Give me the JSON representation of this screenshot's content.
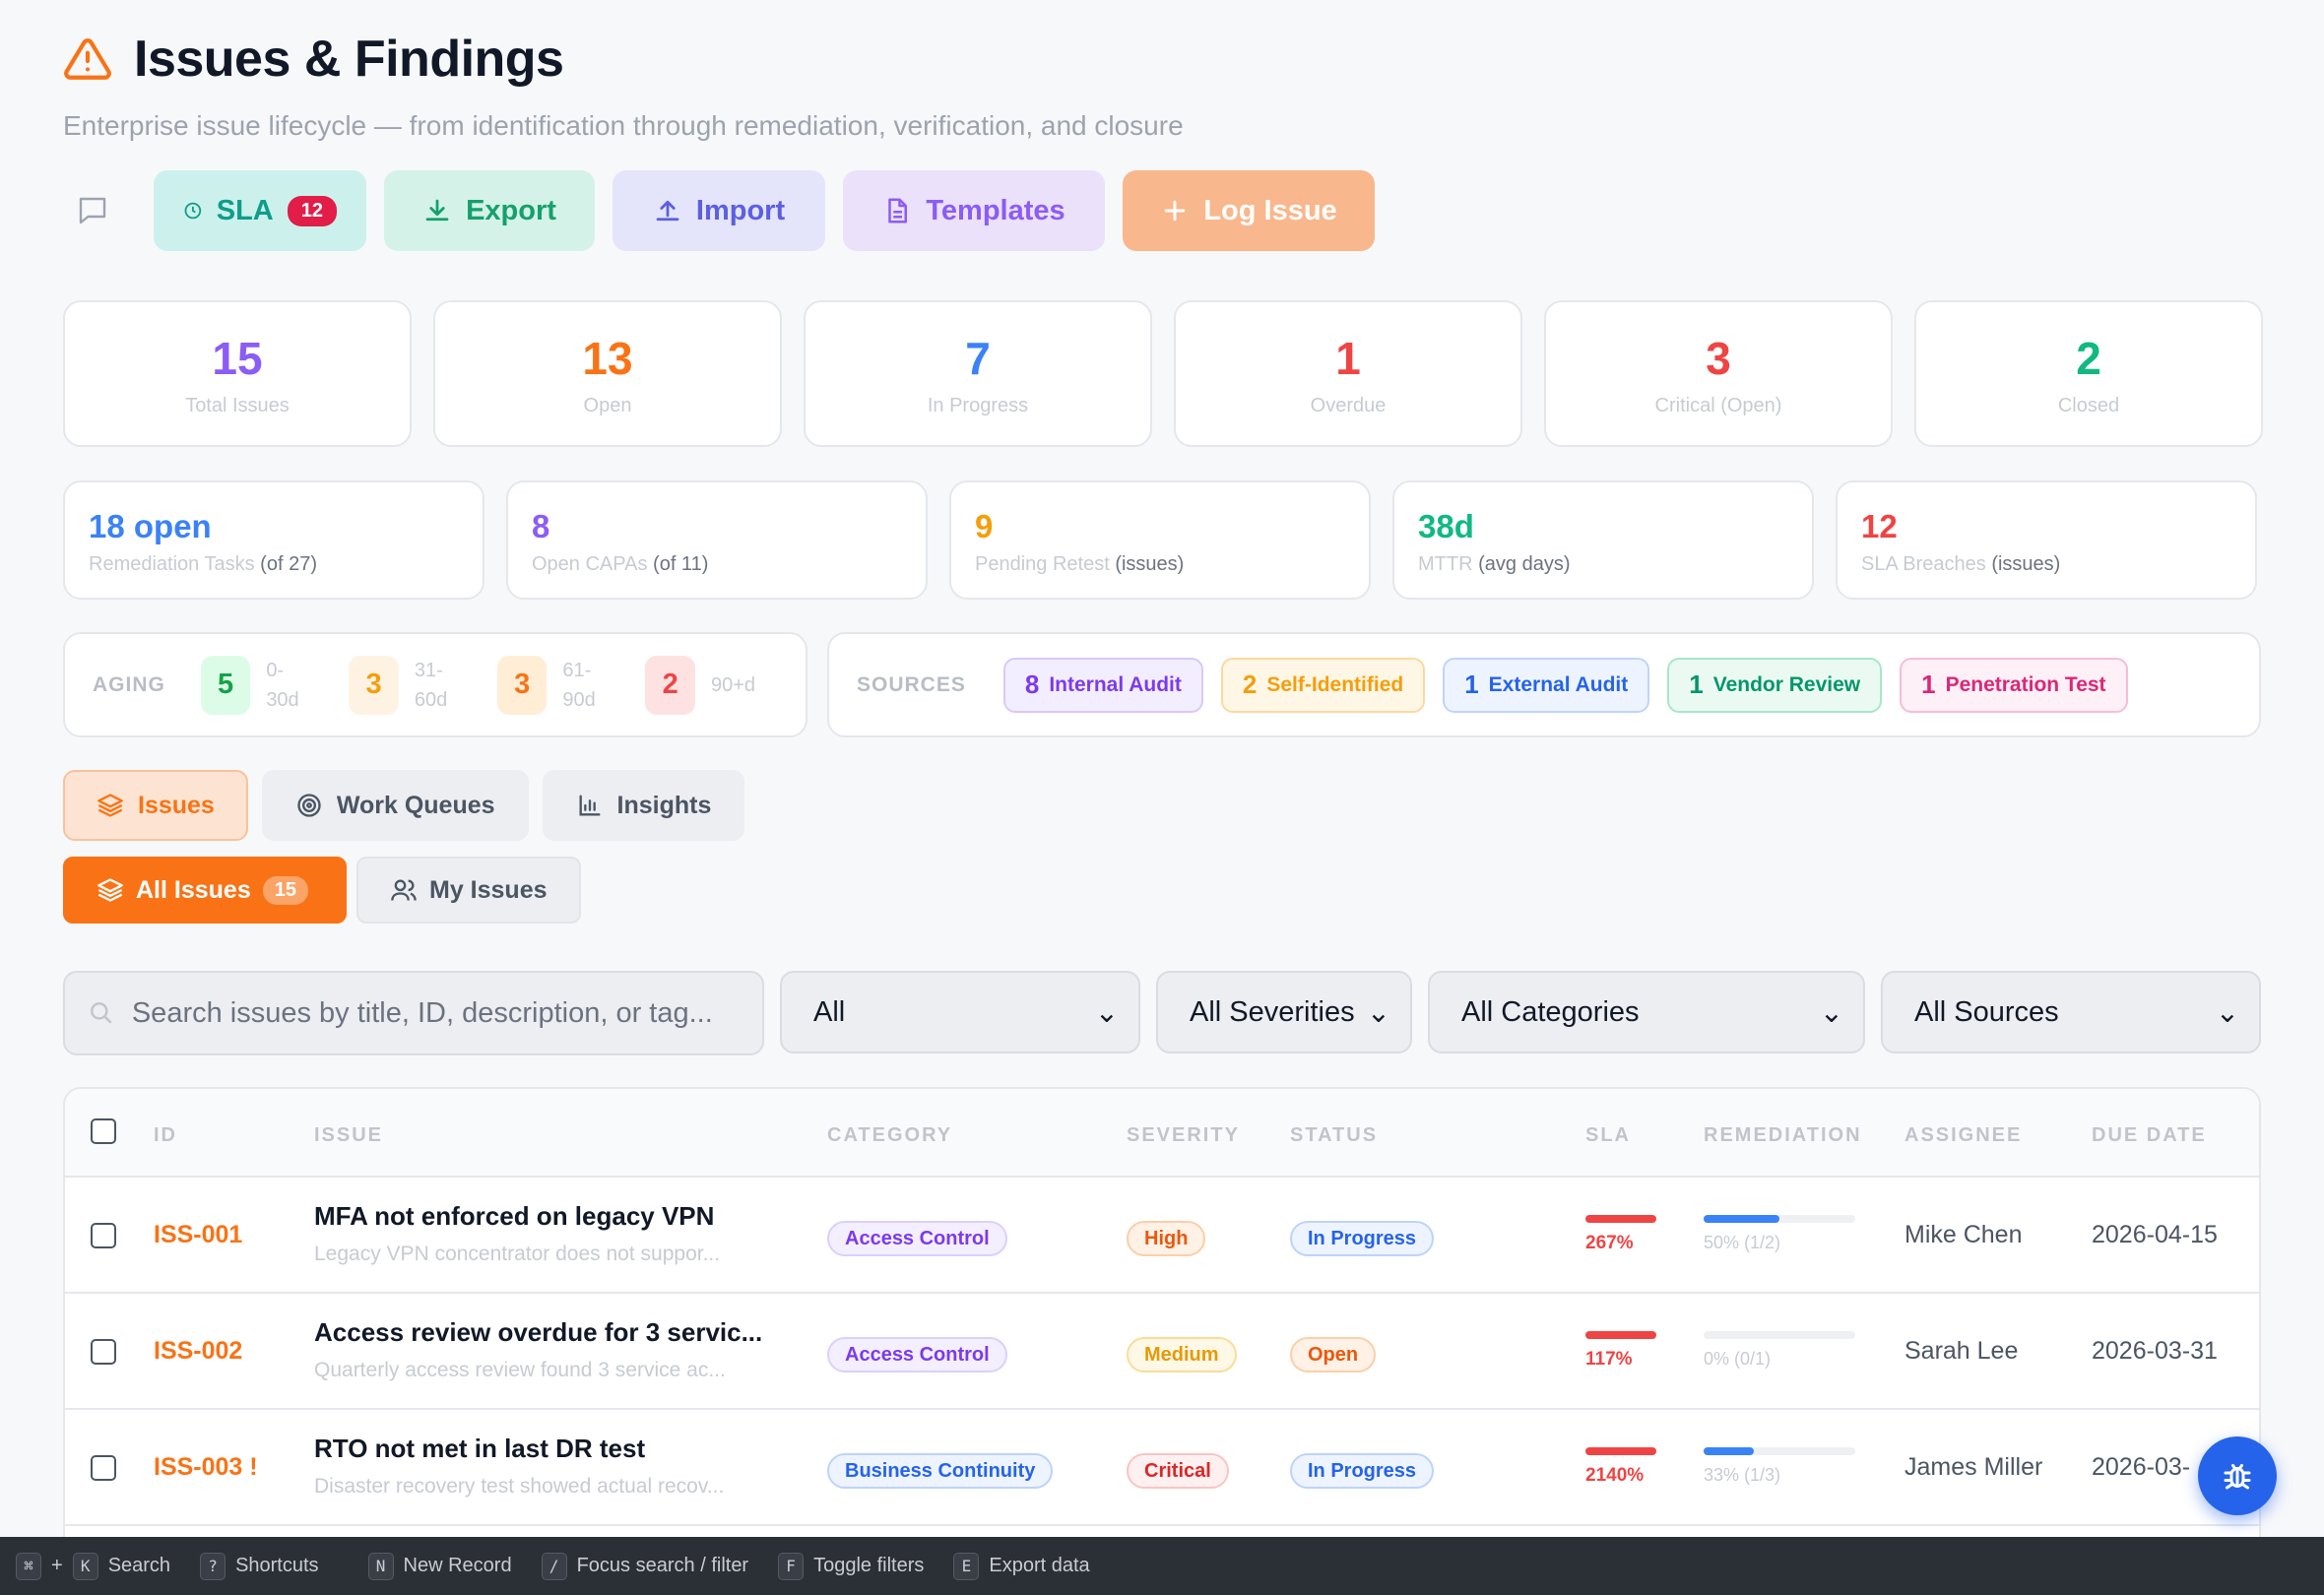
{
  "header": {
    "title": "Issues & Findings",
    "subtitle": "Enterprise issue lifecycle — from identification through remediation, verification, and closure"
  },
  "toolbar": {
    "sla_label": "SLA",
    "sla_count": "12",
    "export_label": "Export",
    "import_label": "Import",
    "templates_label": "Templates",
    "log_label": "Log Issue"
  },
  "stats": [
    {
      "value": "15",
      "label": "Total Issues",
      "color": "#8b5cf6"
    },
    {
      "value": "13",
      "label": "Open",
      "color": "#f97316"
    },
    {
      "value": "7",
      "label": "In Progress",
      "color": "#3b82f6"
    },
    {
      "value": "1",
      "label": "Overdue",
      "color": "#ef4444"
    },
    {
      "value": "3",
      "label": "Critical (Open)",
      "color": "#ef4444"
    },
    {
      "value": "2",
      "label": "Closed",
      "color": "#10b981"
    }
  ],
  "metrics": [
    {
      "value": "18 open",
      "label": "Remediation Tasks",
      "extra": "(of 27)",
      "color": "#3b82f6"
    },
    {
      "value": "8",
      "label": "Open CAPAs",
      "extra": "(of 11)",
      "color": "#8b5cf6"
    },
    {
      "value": "9",
      "label": "Pending Retest",
      "extra": "(issues)",
      "color": "#f59e0b"
    },
    {
      "value": "38d",
      "label": "MTTR",
      "extra": "(avg days)",
      "color": "#10b981"
    },
    {
      "value": "12",
      "label": "SLA Breaches",
      "extra": "(issues)",
      "color": "#ef4444"
    }
  ],
  "aging": {
    "header": "AGING",
    "buckets": [
      {
        "count": "5",
        "l1": "0-",
        "l2": "30d"
      },
      {
        "count": "3",
        "l1": "31-",
        "l2": "60d"
      },
      {
        "count": "3",
        "l1": "61-",
        "l2": "90d"
      },
      {
        "count": "2",
        "l1": "90+d",
        "l2": ""
      }
    ]
  },
  "sources": {
    "header": "SOURCES",
    "items": [
      {
        "count": "8",
        "label": "Internal Audit"
      },
      {
        "count": "2",
        "label": "Self-Identified"
      },
      {
        "count": "1",
        "label": "External Audit"
      },
      {
        "count": "1",
        "label": "Vendor Review"
      },
      {
        "count": "1",
        "label": "Penetration Test"
      }
    ]
  },
  "tabs": {
    "issues": "Issues",
    "queues": "Work Queues",
    "insights": "Insights"
  },
  "subtabs": {
    "all": "All Issues",
    "all_count": "15",
    "mine": "My Issues"
  },
  "filters": {
    "search_placeholder": "Search issues by title, ID, description, or tag...",
    "status": "All",
    "severity": "All Severities",
    "category": "All Categories",
    "source": "All Sources"
  },
  "table": {
    "columns": {
      "id": "ID",
      "issue": "ISSUE",
      "category": "CATEGORY",
      "severity": "SEVERITY",
      "status": "STATUS",
      "sla": "SLA",
      "remediation": "REMEDIATION",
      "assignee": "ASSIGNEE",
      "due": "DUE DATE"
    },
    "rows": [
      {
        "id": "ISS-001",
        "title": "MFA not enforced on legacy VPN",
        "desc": "Legacy VPN concentrator does not suppor...",
        "category": "Access Control",
        "severity": "High",
        "status": "In Progress",
        "sla": "267%",
        "remediation_pct": 0.5,
        "remediation_label": "50% (1/2)",
        "assignee": "Mike Chen",
        "due": "2026-04-15"
      },
      {
        "id": "ISS-002",
        "title": "Access review overdue for 3 servic...",
        "desc": "Quarterly access review found 3 service ac...",
        "category": "Access Control",
        "severity": "Medium",
        "status": "Open",
        "sla": "117%",
        "remediation_pct": 0,
        "remediation_label": "0% (0/1)",
        "assignee": "Sarah Lee",
        "due": "2026-03-31"
      },
      {
        "id": "ISS-003 !",
        "title": "RTO not met in last DR test",
        "desc": "Disaster recovery test showed actual recov...",
        "category": "Business Continuity",
        "severity": "Critical",
        "status": "In Progress",
        "sla": "2140%",
        "remediation_pct": 0.33,
        "remediation_label": "33% (1/3)",
        "assignee": "James Miller",
        "due": "2026-03-"
      }
    ]
  },
  "shortcuts": [
    {
      "keys": [
        "⌘",
        "K"
      ],
      "label": "Search"
    },
    {
      "keys": [
        "?"
      ],
      "label": "Shortcuts"
    },
    {
      "keys": [
        "N"
      ],
      "label": "New Record"
    },
    {
      "keys": [
        "/"
      ],
      "label": "Focus search / filter"
    },
    {
      "keys": [
        "F"
      ],
      "label": "Toggle filters"
    },
    {
      "keys": [
        "E"
      ],
      "label": "Export data"
    }
  ]
}
